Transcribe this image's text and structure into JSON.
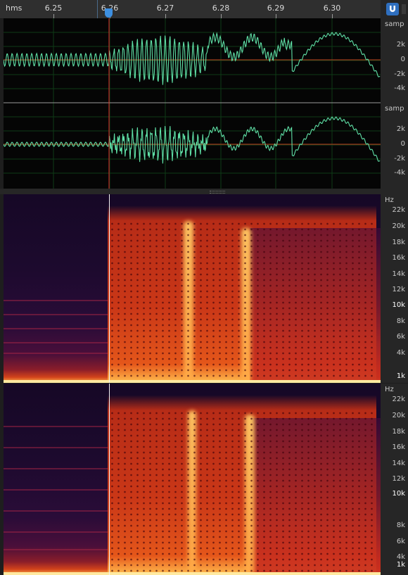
{
  "ruler": {
    "unit": "hms",
    "ticks": [
      "6.25",
      "6.26",
      "6.27",
      "6.28",
      "6.29",
      "6.30"
    ]
  },
  "waveform_axis": {
    "channel_1": {
      "unit": "samp",
      "labels": [
        "2k",
        "0",
        "-2k",
        "-4k"
      ]
    },
    "channel_2": {
      "unit": "samp",
      "labels": [
        "2k",
        "0",
        "-2k",
        "-4k"
      ]
    }
  },
  "spectrogram_axis": {
    "channel_1": {
      "unit": "Hz",
      "labels": [
        "22k",
        "20k",
        "18k",
        "16k",
        "14k",
        "12k",
        "10k",
        "8k",
        "6k",
        "4k",
        "1k"
      ]
    },
    "channel_2": {
      "unit": "Hz",
      "labels": [
        "22k",
        "20k",
        "18k",
        "16k",
        "14k",
        "12k",
        "10k",
        "8k",
        "6k",
        "4k",
        "1k"
      ]
    }
  },
  "colors": {
    "waveform": "#5fe0a6",
    "playhead": "#e0302c",
    "zero_line": "#c2401e",
    "grid": "#0f3a16",
    "accent": "#3d8fe0"
  },
  "icons": {
    "snap": "magnet-icon"
  }
}
